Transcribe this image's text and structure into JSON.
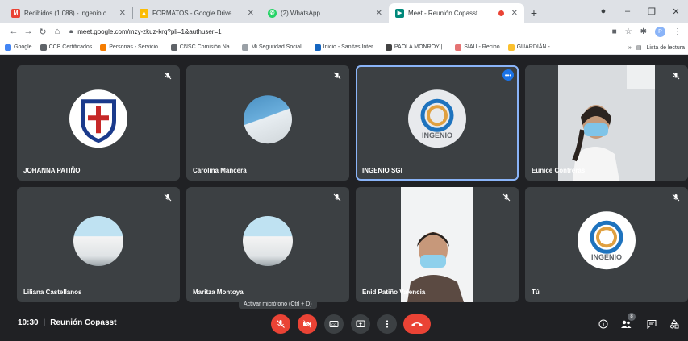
{
  "browser": {
    "tabs": [
      {
        "label": "Recibidos (1.088) - ingenio.cons",
        "icon": "gmail-icon",
        "color": "#ea4335",
        "letter": "M"
      },
      {
        "label": "FORMATOS - Google Drive",
        "icon": "drive-icon",
        "color": "#fbbc04",
        "letter": "▲"
      },
      {
        "label": "(2) WhatsApp",
        "icon": "whatsapp-icon",
        "color": "#25d366",
        "letter": "✆"
      },
      {
        "label": "Meet - Reunión Copasst",
        "icon": "meet-icon",
        "color": "#00897b",
        "letter": "▶"
      }
    ],
    "url": "meet.google.com/mzy-zkuz-krq?pli=1&authuser=1",
    "profile_letter": "P",
    "bookmarks": [
      {
        "label": "Google",
        "color": "#4285f4"
      },
      {
        "label": "CCB Certificados",
        "color": "#5f6368"
      },
      {
        "label": "Personas - Servicio...",
        "color": "#f57c00"
      },
      {
        "label": "CNSC Comisión Na...",
        "color": "#5f6368"
      },
      {
        "label": "Mi Seguridad Social...",
        "color": "#9aa0a6"
      },
      {
        "label": "Inicio - Sanitas Inter...",
        "color": "#1565c0"
      },
      {
        "label": "PAOLA MONROY |...",
        "color": "#424242"
      },
      {
        "label": "SIAU - Recibo",
        "color": "#e57373"
      },
      {
        "label": "GUARDIÁN -",
        "color": "#fbc02d"
      }
    ],
    "reading_list": "Lista de lectura"
  },
  "participants": [
    {
      "name": "JOHANNA PATIÑO",
      "kind": "shield"
    },
    {
      "name": "Carolina Mancera",
      "kind": "photo"
    },
    {
      "name": "INGENIO SGI",
      "kind": "logo"
    },
    {
      "name": "Eunice Contreras",
      "kind": "video"
    },
    {
      "name": "Liliana Castellanos",
      "kind": "building"
    },
    {
      "name": "Maritza Montoya",
      "kind": "building"
    },
    {
      "name": "Enid Patiño Valencia",
      "kind": "video"
    },
    {
      "name": "Tú",
      "kind": "logo"
    }
  ],
  "logo_text": "INGENIO",
  "meeting": {
    "time": "10:30",
    "name": "Reunión Copasst",
    "mic_tooltip": "Activar micrófono (Ctrl + D)",
    "participant_count": "8"
  },
  "colors": {
    "accent": "#8ab4f8",
    "danger": "#ea4335",
    "tile": "#3c4043"
  }
}
